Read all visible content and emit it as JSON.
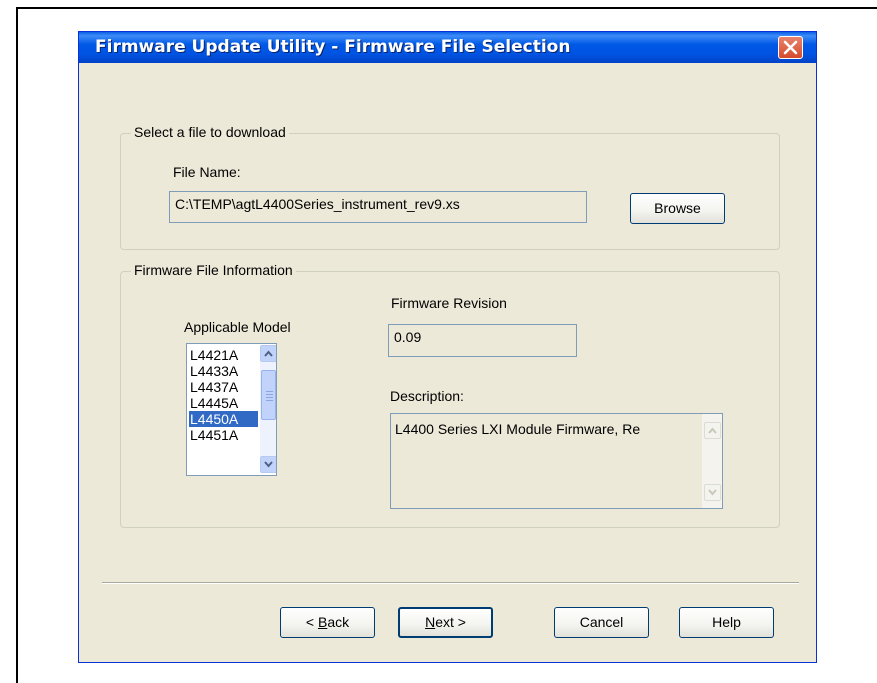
{
  "window": {
    "title": "Firmware Update Utility - Firmware File Selection"
  },
  "file_group": {
    "legend": "Select a file to download",
    "file_name_label": "File Name:",
    "file_name_value": "C:\\TEMP\\agtL4400Series_instrument_rev9.xs",
    "browse_label": "Browse"
  },
  "info_group": {
    "legend": "Firmware File Information",
    "applicable_model_label": "Applicable Model",
    "models": [
      "L4421A",
      "L4433A",
      "L4437A",
      "L4445A",
      "L4450A",
      "L4451A"
    ],
    "selected_model": "L4450A",
    "firmware_revision_label": "Firmware Revision",
    "firmware_revision_value": "0.09",
    "description_label": "Description:",
    "description_value": "L4400 Series LXI Module Firmware, Re"
  },
  "buttons": {
    "back_prefix": "< ",
    "back_accel": "B",
    "back_rest": "ack",
    "next_accel": "N",
    "next_rest": "ext >",
    "cancel": "Cancel",
    "help": "Help"
  },
  "colors": {
    "title_bar": "#0054e3",
    "dialog_bg": "#ece9d8",
    "selection": "#316ac5",
    "close_button": "#d54b2c"
  }
}
